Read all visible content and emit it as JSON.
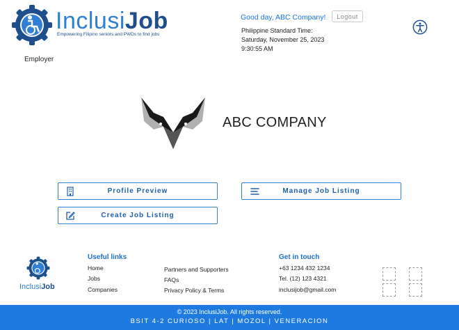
{
  "brand": {
    "name_part1": "Inclusi",
    "name_part2": "Job",
    "tagline": "Empowering Filipino seniors and PWDs to find jobs",
    "accent": "#2f7fd6",
    "dark": "#1e4e8c"
  },
  "header": {
    "role": "Employer",
    "greeting": "Good day, ABC Company!",
    "logout_label": "Logout",
    "time_label": "Philippine Standard Time:",
    "date": "Saturday, November 25, 2023",
    "clock": "9:30:55 AM",
    "accessibility_icon": "accessibility-icon"
  },
  "company": {
    "name": "ABC COMPANY"
  },
  "actions": [
    {
      "label": "Profile Preview",
      "icon": "building-icon"
    },
    {
      "label": "Manage Job Listing",
      "icon": "list-icon"
    },
    {
      "label": "Create Job Listing",
      "icon": "edit-icon"
    }
  ],
  "footer": {
    "logo_part1": "Inclusi",
    "logo_part2": "Job",
    "useful_links_title": "Useful links",
    "links_col1": [
      "Home",
      "Jobs",
      "Companies"
    ],
    "links_col2": [
      "Partners and Supporters",
      "FAQs",
      "Privacy Policy & Terms"
    ],
    "contact_title": "Get in touch",
    "contact": [
      "+63 1234 432 1234",
      "Tel. (12) 123 4321",
      "inclusijob@gmail.com"
    ],
    "copyright": "© 2023 InclusiJob. All rights reserved.",
    "credits": "BSIT 4-2 CURIOSO | LAT | MOZOL | VENERACION",
    "bar_color": "#1f7ae0"
  }
}
